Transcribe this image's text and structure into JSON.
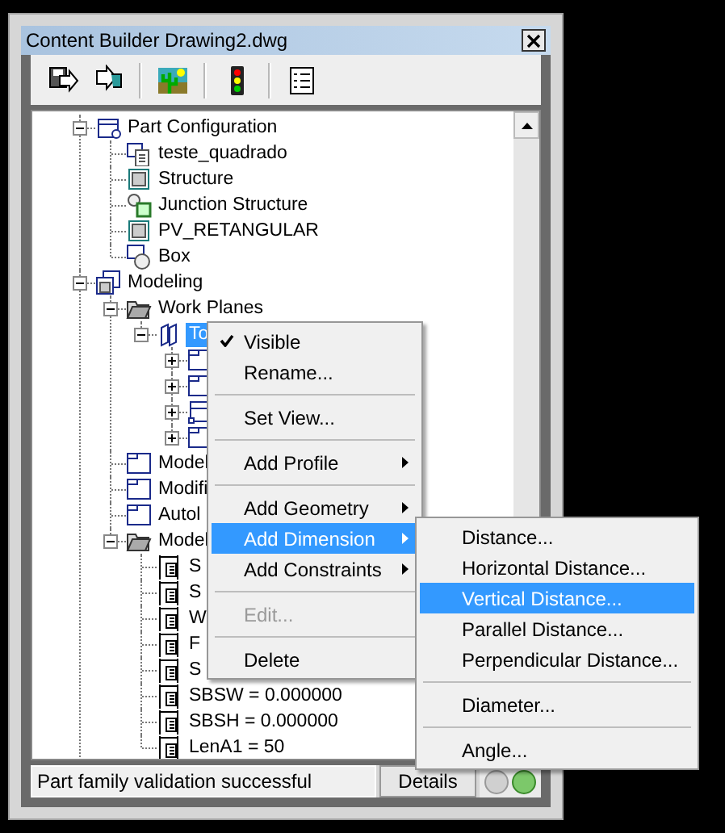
{
  "window": {
    "title": "Content Builder Drawing2.dwg"
  },
  "tree": [
    {
      "label": "Part Configuration",
      "kind": "config",
      "expanded": true,
      "selected": false,
      "children": [
        {
          "label": "teste_quadrado",
          "kind": "document",
          "selected": false
        },
        {
          "label": "Structure",
          "kind": "part",
          "selected": false
        },
        {
          "label": "Junction Structure",
          "kind": "junction",
          "selected": false
        },
        {
          "label": "PV_RETANGULAR",
          "kind": "part",
          "selected": false
        },
        {
          "label": "Box",
          "kind": "box",
          "selected": false
        }
      ]
    },
    {
      "label": "Modeling",
      "kind": "modeling",
      "expanded": true,
      "selected": false,
      "children": [
        {
          "label": "Work Planes",
          "kind": "folder-open",
          "expanded": true,
          "selected": false,
          "children": [
            {
              "label": "To",
              "kind": "plane",
              "expanded": true,
              "selected": true,
              "children": [
                {
                  "kind": "folder",
                  "expanded": false
                },
                {
                  "kind": "folder",
                  "expanded": false
                },
                {
                  "kind": "profile",
                  "expanded": false
                },
                {
                  "kind": "folder",
                  "expanded": false
                }
              ]
            }
          ]
        },
        {
          "label": "Model",
          "kind": "folder",
          "selected": false
        },
        {
          "label": "Modifi",
          "kind": "folder",
          "selected": false
        },
        {
          "label": "Autol",
          "kind": "folder",
          "selected": false
        },
        {
          "label": "Model",
          "kind": "folder-open",
          "expanded": true,
          "selected": false,
          "children": [
            {
              "label": "S",
              "kind": "parameter",
              "selected": false
            },
            {
              "label": "S",
              "kind": "parameter",
              "selected": false
            },
            {
              "label": "W",
              "kind": "parameter",
              "selected": false
            },
            {
              "label": "F",
              "kind": "parameter",
              "selected": false
            },
            {
              "label": "S",
              "kind": "parameter",
              "selected": false
            },
            {
              "label": "SBSW = 0.000000",
              "kind": "parameter",
              "selected": false
            },
            {
              "label": "SBSH = 0.000000",
              "kind": "parameter",
              "selected": false
            },
            {
              "label": "LenA1 = 50",
              "kind": "parameter",
              "selected": false
            }
          ]
        }
      ]
    }
  ],
  "context_menu": [
    {
      "kind": "item",
      "label": "Visible",
      "checked": true,
      "disabled": false,
      "selected": false,
      "submenu": false
    },
    {
      "kind": "item",
      "label": "Rename...",
      "checked": false,
      "disabled": false,
      "selected": false,
      "submenu": false
    },
    {
      "kind": "separator"
    },
    {
      "kind": "item",
      "label": "Set View...",
      "checked": false,
      "disabled": false,
      "selected": false,
      "submenu": false
    },
    {
      "kind": "separator"
    },
    {
      "kind": "item",
      "label": "Add Profile",
      "checked": false,
      "disabled": false,
      "selected": false,
      "submenu": true
    },
    {
      "kind": "separator"
    },
    {
      "kind": "item",
      "label": "Add Geometry",
      "checked": false,
      "disabled": false,
      "selected": false,
      "submenu": true
    },
    {
      "kind": "item",
      "label": "Add Dimension",
      "checked": false,
      "disabled": false,
      "selected": true,
      "submenu": true
    },
    {
      "kind": "item",
      "label": "Add Constraints",
      "checked": false,
      "disabled": false,
      "selected": false,
      "submenu": true
    },
    {
      "kind": "separator"
    },
    {
      "kind": "item",
      "label": "Edit...",
      "checked": false,
      "disabled": true,
      "selected": false,
      "submenu": false
    },
    {
      "kind": "separator"
    },
    {
      "kind": "item",
      "label": "Delete",
      "checked": false,
      "disabled": false,
      "selected": false,
      "submenu": false
    }
  ],
  "submenu": [
    {
      "kind": "item",
      "label": "Distance...",
      "selected": false
    },
    {
      "kind": "item",
      "label": "Horizontal Distance...",
      "selected": false
    },
    {
      "kind": "item",
      "label": "Vertical Distance...",
      "selected": true
    },
    {
      "kind": "item",
      "label": "Parallel Distance...",
      "selected": false
    },
    {
      "kind": "item",
      "label": "Perpendicular Distance...",
      "selected": false
    },
    {
      "kind": "separator"
    },
    {
      "kind": "item",
      "label": "Diameter...",
      "selected": false
    },
    {
      "kind": "separator"
    },
    {
      "kind": "item",
      "label": "Angle...",
      "selected": false
    }
  ],
  "status_bar": {
    "message": "Part family validation successful",
    "button": "Details",
    "lights": [
      {
        "on": false
      },
      {
        "on": true
      }
    ]
  }
}
